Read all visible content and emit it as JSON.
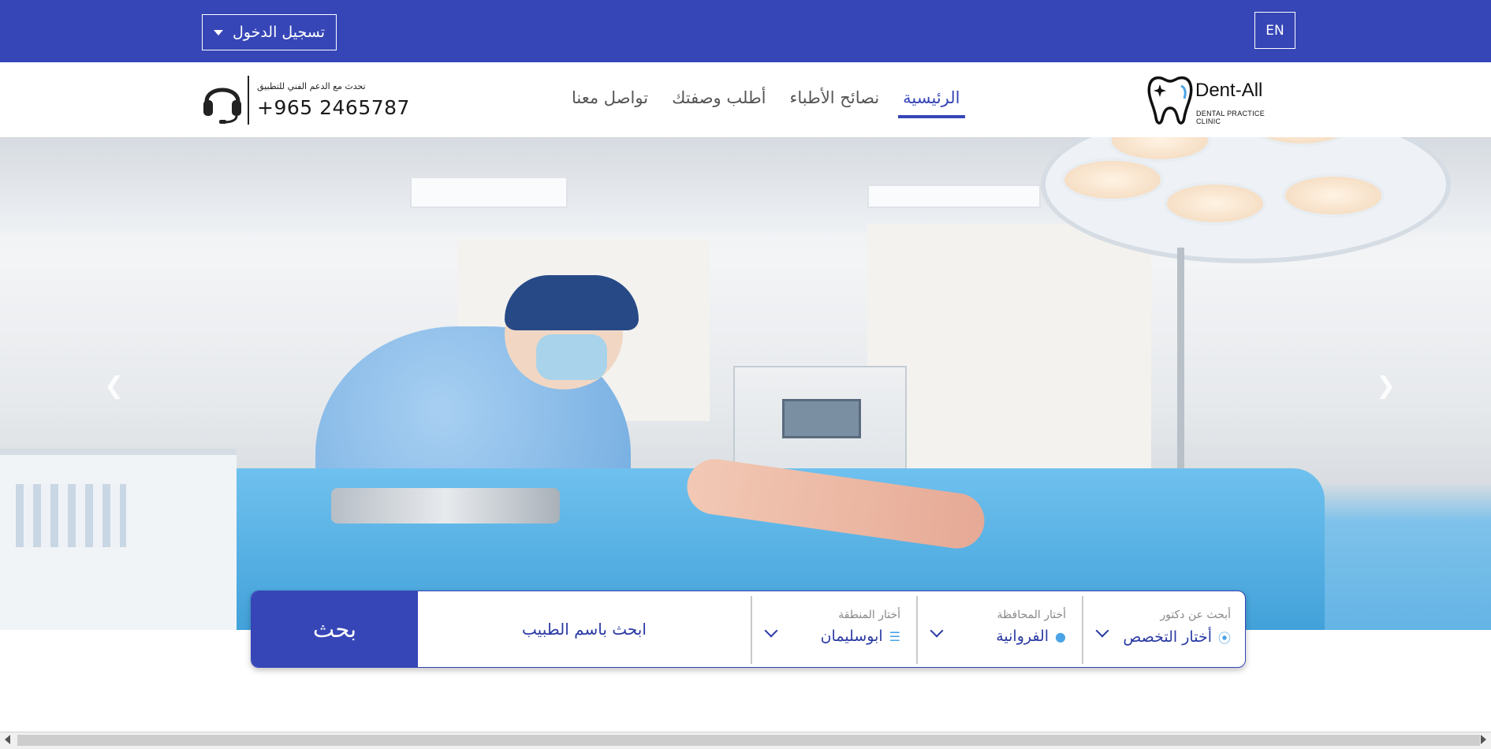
{
  "topbar": {
    "login_label": "تسجيل الدخول",
    "language_label": "EN"
  },
  "header": {
    "support_note": "تحدث مع الدعم الفني للتطبيق",
    "support_phone": "+965 2465787",
    "nav": [
      {
        "label": "الرئيسية",
        "active": true
      },
      {
        "label": "نصائح الأطباء",
        "active": false
      },
      {
        "label": "أطلب وصفتك",
        "active": false
      },
      {
        "label": "تواصل معنا",
        "active": false
      }
    ],
    "logo_text": "Dent-All",
    "logo_subtitle": "DENTAL PRACTICE CLINIC"
  },
  "search": {
    "button_label": "بحث",
    "doctor_name_placeholder": "ابحث باسم الطبيب",
    "specialty": {
      "label": "أبحث عن دكتور",
      "value": "أختار التخصص",
      "icon": "stethoscope-icon"
    },
    "governorate": {
      "label": "أختار المحافظة",
      "value": "الفروانية",
      "icon": "location-pin-icon"
    },
    "area": {
      "label": "أختار المنطقة",
      "value": "ابوسليمان",
      "icon": "signpost-icon"
    }
  },
  "colors": {
    "primary": "#3646b7",
    "accent_icon": "#4aa3e6"
  }
}
